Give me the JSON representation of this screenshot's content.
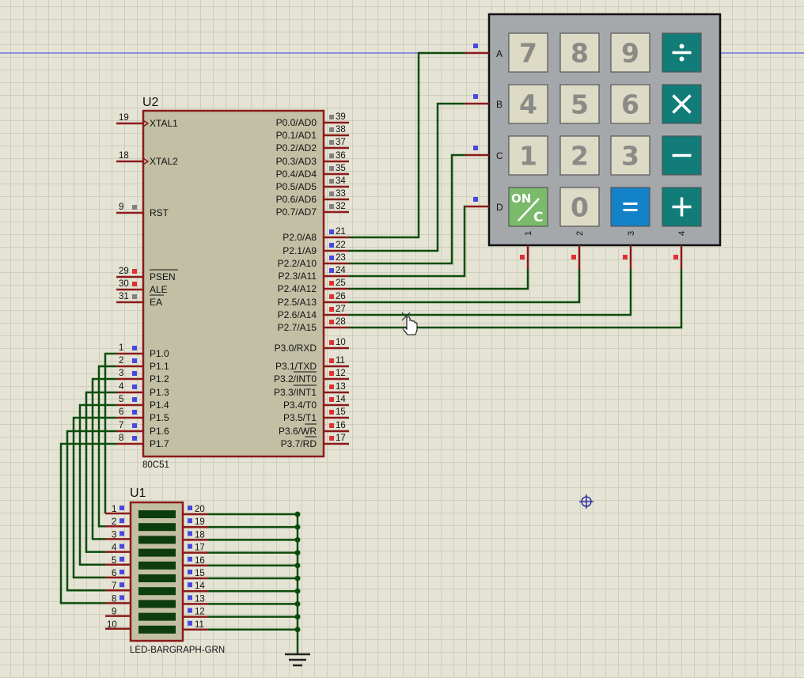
{
  "schematic": {
    "mcu": {
      "ref": "U2",
      "part": "80C51",
      "left_pins": [
        {
          "num": "19",
          "name": "XTAL1"
        },
        {
          "num": "18",
          "name": "XTAL2"
        },
        {
          "num": "9",
          "name": "RST"
        },
        {
          "num": "29",
          "name": "PSEN"
        },
        {
          "num": "30",
          "name": "ALE"
        },
        {
          "num": "31",
          "name": "EA"
        },
        {
          "num": "1",
          "name": "P1.0"
        },
        {
          "num": "2",
          "name": "P1.1"
        },
        {
          "num": "3",
          "name": "P1.2"
        },
        {
          "num": "4",
          "name": "P1.3"
        },
        {
          "num": "5",
          "name": "P1.4"
        },
        {
          "num": "6",
          "name": "P1.5"
        },
        {
          "num": "7",
          "name": "P1.6"
        },
        {
          "num": "8",
          "name": "P1.7"
        }
      ],
      "right_pins": [
        {
          "num": "39",
          "name": "P0.0/AD0"
        },
        {
          "num": "38",
          "name": "P0.1/AD1"
        },
        {
          "num": "37",
          "name": "P0.2/AD2"
        },
        {
          "num": "36",
          "name": "P0.3/AD3"
        },
        {
          "num": "35",
          "name": "P0.4/AD4"
        },
        {
          "num": "34",
          "name": "P0.5/AD5"
        },
        {
          "num": "33",
          "name": "P0.6/AD6"
        },
        {
          "num": "32",
          "name": "P0.7/AD7"
        },
        {
          "num": "21",
          "name": "P2.0/A8"
        },
        {
          "num": "22",
          "name": "P2.1/A9"
        },
        {
          "num": "23",
          "name": "P2.2/A10"
        },
        {
          "num": "24",
          "name": "P2.3/A11"
        },
        {
          "num": "25",
          "name": "P2.4/A12"
        },
        {
          "num": "26",
          "name": "P2.5/A13"
        },
        {
          "num": "27",
          "name": "P2.6/A14"
        },
        {
          "num": "28",
          "name": "P2.7/A15"
        },
        {
          "num": "10",
          "name": "P3.0/RXD"
        },
        {
          "num": "11",
          "name": "P3.1/TXD"
        },
        {
          "num": "12",
          "name": "P3.2/INT0"
        },
        {
          "num": "13",
          "name": "P3.3/INT1"
        },
        {
          "num": "14",
          "name": "P3.4/T0"
        },
        {
          "num": "15",
          "name": "P3.5/T1"
        },
        {
          "num": "16",
          "name": "P3.6/WR"
        },
        {
          "num": "17",
          "name": "P3.7/RD"
        }
      ]
    },
    "bargraph": {
      "ref": "U1",
      "part": "LED-BARGRAPH-GRN",
      "left_nums": [
        "1",
        "2",
        "3",
        "4",
        "5",
        "6",
        "7",
        "8",
        "9",
        "10"
      ],
      "right_nums": [
        "20",
        "19",
        "18",
        "17",
        "16",
        "15",
        "14",
        "13",
        "12",
        "11"
      ]
    },
    "keypad": {
      "row_labels": [
        "A",
        "B",
        "C",
        "D"
      ],
      "col_labels": [
        "1",
        "2",
        "3",
        "4"
      ],
      "keys": [
        [
          {
            "label": "7",
            "kind": "digit"
          },
          {
            "label": "8",
            "kind": "digit"
          },
          {
            "label": "9",
            "kind": "digit"
          },
          {
            "label": "÷",
            "kind": "op"
          }
        ],
        [
          {
            "label": "4",
            "kind": "digit"
          },
          {
            "label": "5",
            "kind": "digit"
          },
          {
            "label": "6",
            "kind": "digit"
          },
          {
            "label": "×",
            "kind": "op"
          }
        ],
        [
          {
            "label": "1",
            "kind": "digit"
          },
          {
            "label": "2",
            "kind": "digit"
          },
          {
            "label": "3",
            "kind": "digit"
          },
          {
            "label": "−",
            "kind": "op"
          }
        ],
        [
          {
            "label": "ON/C",
            "kind": "on"
          },
          {
            "label": "0",
            "kind": "digit"
          },
          {
            "label": "=",
            "kind": "eq"
          },
          {
            "label": "+",
            "kind": "op"
          }
        ]
      ]
    }
  },
  "colors": {
    "wire": "#0b4d0b",
    "pin_stub": "#8b1a1a",
    "body_fill": "#c2bfa5",
    "pin_blue": "#4848e0",
    "pin_red": "#e03030",
    "pin_gray": "#808080",
    "led_bar": "#0d3d0d",
    "key_digit": "#dddbc6",
    "key_op": "#117c78",
    "key_eq": "#1482c8",
    "key_on": "#7aba6a",
    "keypad_frame": "#a5a8ab"
  },
  "icons": [
    "hand-cursor-icon",
    "crosshair-icon",
    "ground-icon"
  ]
}
